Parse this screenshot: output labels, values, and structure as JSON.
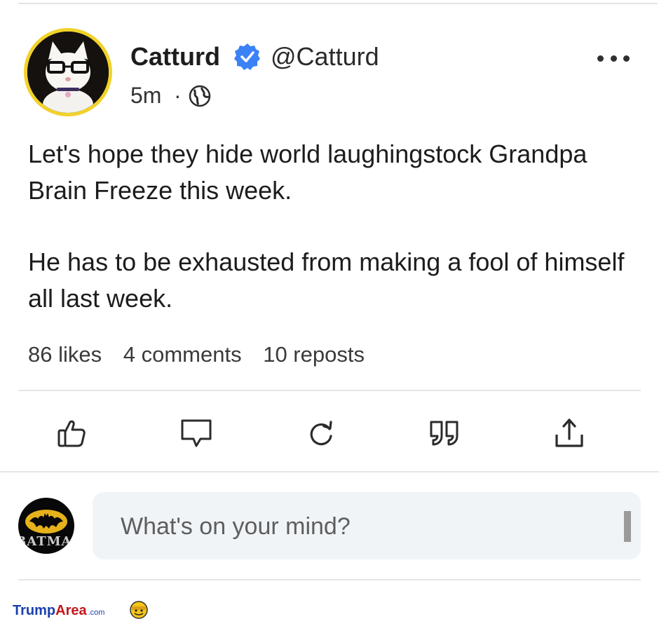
{
  "post": {
    "author_name": "Catturd",
    "verified_icon": "verified-check-icon",
    "handle": "@Catturd",
    "time": "5m",
    "separator": "·",
    "visibility_icon": "globe-icon",
    "body_paragraphs": [
      "Let's hope they hide world laughingstock Grandpa Brain Freeze this week.",
      "He has to be exhausted from making a fool of himself all last week."
    ],
    "stats": {
      "likes": "86 likes",
      "comments": "4 comments",
      "reposts": "10 reposts"
    }
  },
  "actions": [
    "like-icon",
    "comment-icon",
    "repost-icon",
    "quote-icon",
    "share-icon"
  ],
  "composer": {
    "placeholder": "What's on your mind?",
    "avatar_text": "BATMAN"
  },
  "watermark": {
    "part1": "Trump",
    "part2": "Area",
    "part3": ".com"
  },
  "colors": {
    "verified": "#3b82f6",
    "avatar_border": "#f2d22a",
    "composer_bg": "#f1f4f7"
  }
}
